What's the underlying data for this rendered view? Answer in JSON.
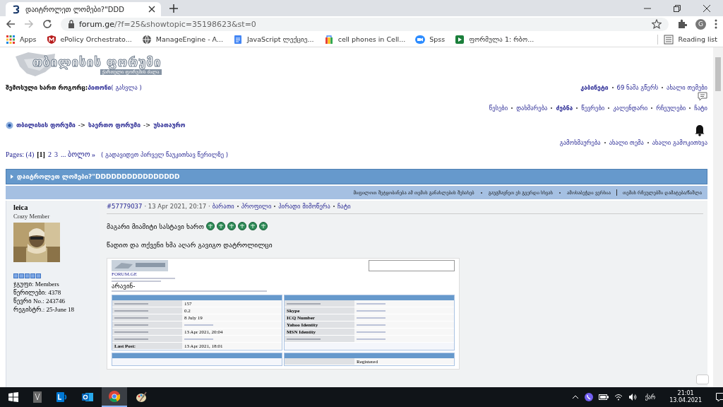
{
  "browser": {
    "tab_title": "დაიტროლეთ ლომები?\"DDD",
    "url_host": "forum.ge",
    "url_path": "/?f=25&showtopic=35198623&st=0",
    "bookmarks": [
      {
        "label": "Apps",
        "kind": "apps"
      },
      {
        "label": "ePolicy Orchestrato...",
        "kind": "shield"
      },
      {
        "label": "ManageEngine - A...",
        "kind": "globe"
      },
      {
        "label": "JavaScript ლექციე...",
        "kind": "doc"
      },
      {
        "label": "cell phones in Cell...",
        "kind": "bag"
      },
      {
        "label": "Spss",
        "kind": "video"
      },
      {
        "label": "ფორმულა 1: რბო...",
        "kind": "play"
      }
    ],
    "reading_list": "Reading list",
    "profile_initial": "G"
  },
  "forum": {
    "logo_title": "თბილისის ფორუმი",
    "logo_subtitle": "ქართული ფორუმის ძალა",
    "login_prefix": "შემოსული ხართ როგორც:",
    "login_user": "პითონი",
    "logout": "( გასვლა )",
    "user_links": [
      {
        "label": "კაბინეტი",
        "bold": true
      },
      {
        "label": "69 ნაშა გწერს",
        "bold": false
      },
      {
        "label": "ახალი თემები",
        "bold": false
      }
    ],
    "nav": [
      {
        "label": "წესები",
        "selected": false
      },
      {
        "label": "დახმარება",
        "selected": false
      },
      {
        "label": "ძებნა",
        "selected": true
      },
      {
        "label": "წევრები",
        "selected": false
      },
      {
        "label": "კალენდარი",
        "selected": false
      },
      {
        "label": "რჩეულები",
        "selected": false
      },
      {
        "label": "ჩატი",
        "selected": false
      }
    ],
    "breadcrumb": [
      "თბილისის ფორუმი",
      "საერთო ფორუმი",
      "უსათაურო"
    ],
    "breadcrumb_separator": "->",
    "topic_actions": [
      "გამოხმაურება",
      "ახალი თემა",
      "ახალი გამოკითხვა"
    ],
    "pages": {
      "label": "Pages: (4)",
      "items": [
        {
          "label": "[1]",
          "selected": true
        },
        {
          "label": "2",
          "selected": false
        },
        {
          "label": "3",
          "selected": false
        },
        {
          "label": "... ბოლო »",
          "selected": false
        }
      ],
      "first_unread": "( გადავიდეთ პირველ წაუკითხავ წერილზე )"
    },
    "topic_title": "დაიტროლეთ ლომები?\"DDDDDDDDDDDDDDDD",
    "topic_options": [
      "მიფილოთ შეტყობინება ამ თემის განახლების შესახებ",
      "გაუგზავნეთ ეს გვერდი სხვას",
      "ამოსაბეჭდი ვერსია",
      "თემის რჩეულებში დამატება/წაშლა"
    ],
    "post": {
      "author": "leica",
      "rank": "Crazy Member",
      "stars": 5,
      "author_info": [
        "ჯგუფი: Members",
        "წერილები: 4378",
        "წევრი No.: 243746",
        "რეგისტრ.: 25-June 18"
      ],
      "number": "#57779037",
      "date": "· 13 Apr 2021, 20:17 ·",
      "links": [
        "ბარათი",
        "პროფილი",
        "პირადი მიმოწერა",
        "ჩატი"
      ],
      "line_1": "მაგარი მიამიტი სასტავი ხართ",
      "emoticons": [
        {
          "kind": "smiley"
        },
        {
          "kind": "smiley"
        },
        {
          "kind": "smiley"
        },
        {
          "kind": "smiley"
        },
        {
          "kind": "smiley"
        },
        {
          "kind": "smiley"
        }
      ],
      "line_2": "წადით და თქვენი ხმა აღარ გავიგო დატროლილცი",
      "attachment": {
        "site": "FORUM.GE",
        "heading": "არავინ-",
        "left_rows": [
          {
            "value": "157"
          },
          {
            "value": "0.2"
          },
          {
            "value": "8 July 19"
          },
          {},
          {
            "value": "13 Apr 2021, 20:04"
          },
          {},
          {
            "label": "Last Post:",
            "value": "13 Apr 2021, 18:01"
          }
        ],
        "right_rows": [
          {},
          {
            "label": "Skype"
          },
          {
            "label": "ICQ Number"
          },
          {
            "label": "Yahoo Identity"
          },
          {
            "label": "MSN Identity"
          },
          {}
        ],
        "lower_right_value": "Registered"
      }
    }
  },
  "taskbar": {
    "time": "21:01",
    "date": "13.04.2021",
    "language": "ქარ"
  }
}
